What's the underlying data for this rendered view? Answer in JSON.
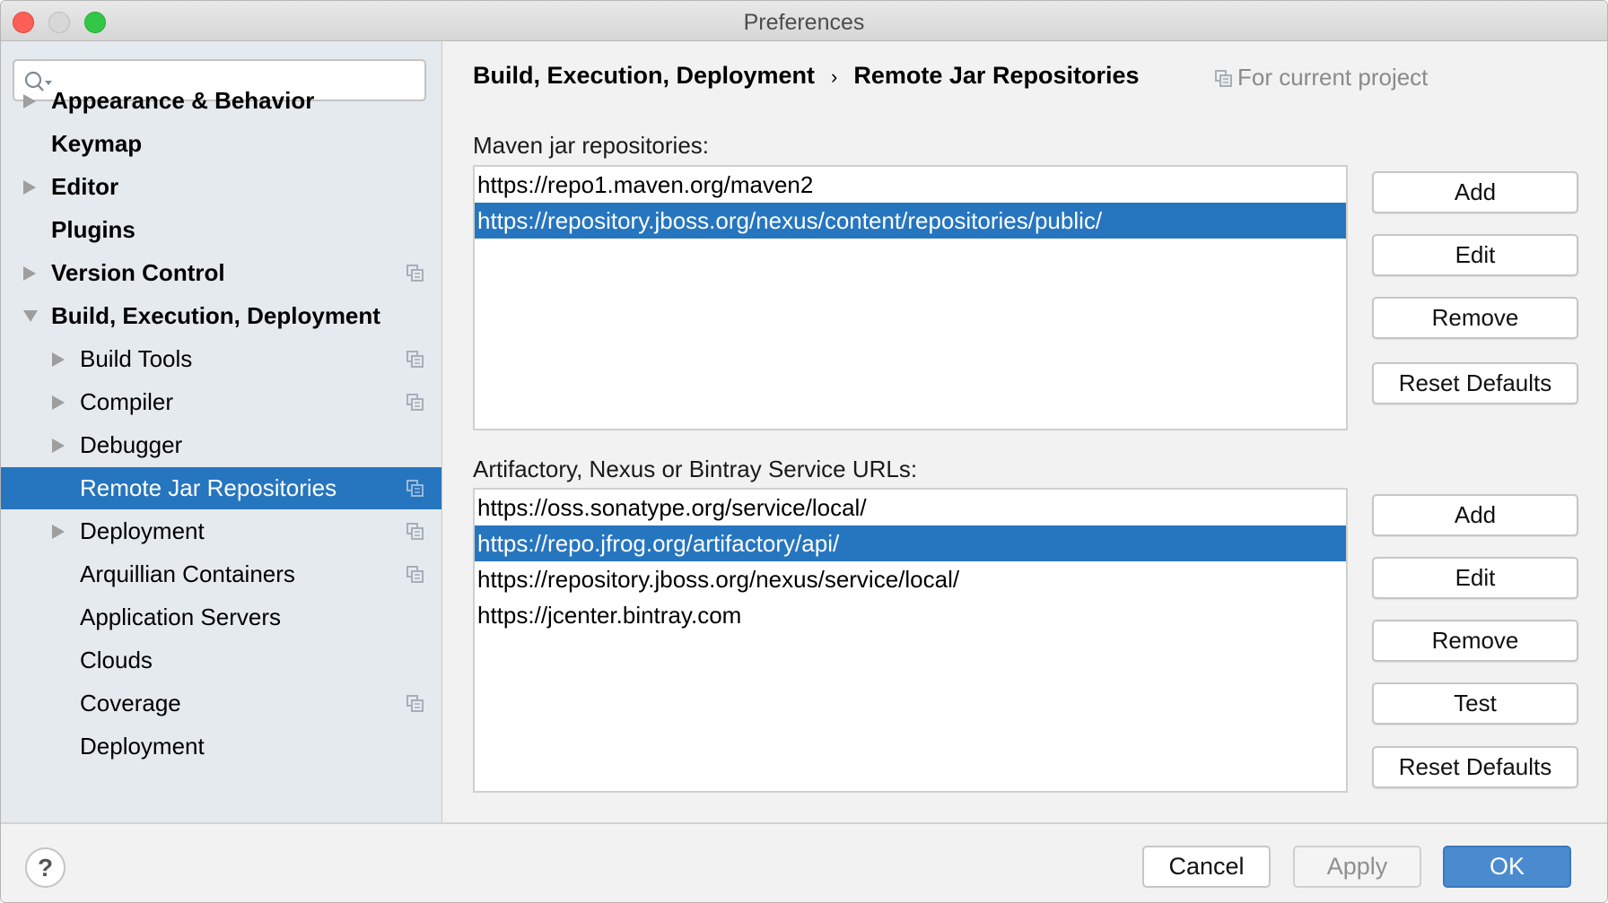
{
  "window": {
    "title": "Preferences"
  },
  "sidebar": {
    "search": {
      "value": "",
      "placeholder": ""
    },
    "items": [
      {
        "label": "Appearance & Behavior",
        "level": 0,
        "expandable": true,
        "expanded": false,
        "project_scoped": false,
        "selected": false
      },
      {
        "label": "Keymap",
        "level": 0,
        "expandable": false,
        "expanded": false,
        "project_scoped": false,
        "selected": false
      },
      {
        "label": "Editor",
        "level": 0,
        "expandable": true,
        "expanded": false,
        "project_scoped": false,
        "selected": false
      },
      {
        "label": "Plugins",
        "level": 0,
        "expandable": false,
        "expanded": false,
        "project_scoped": false,
        "selected": false
      },
      {
        "label": "Version Control",
        "level": 0,
        "expandable": true,
        "expanded": false,
        "project_scoped": true,
        "selected": false
      },
      {
        "label": "Build, Execution, Deployment",
        "level": 0,
        "expandable": true,
        "expanded": true,
        "project_scoped": false,
        "selected": false
      },
      {
        "label": "Build Tools",
        "level": 1,
        "expandable": true,
        "expanded": false,
        "project_scoped": true,
        "selected": false
      },
      {
        "label": "Compiler",
        "level": 1,
        "expandable": true,
        "expanded": false,
        "project_scoped": true,
        "selected": false
      },
      {
        "label": "Debugger",
        "level": 1,
        "expandable": true,
        "expanded": false,
        "project_scoped": false,
        "selected": false
      },
      {
        "label": "Remote Jar Repositories",
        "level": 1,
        "expandable": false,
        "expanded": false,
        "project_scoped": true,
        "selected": true
      },
      {
        "label": "Deployment",
        "level": 1,
        "expandable": true,
        "expanded": false,
        "project_scoped": true,
        "selected": false
      },
      {
        "label": "Arquillian Containers",
        "level": 1,
        "expandable": false,
        "expanded": false,
        "project_scoped": true,
        "selected": false
      },
      {
        "label": "Application Servers",
        "level": 1,
        "expandable": false,
        "expanded": false,
        "project_scoped": false,
        "selected": false
      },
      {
        "label": "Clouds",
        "level": 1,
        "expandable": false,
        "expanded": false,
        "project_scoped": false,
        "selected": false
      },
      {
        "label": "Coverage",
        "level": 1,
        "expandable": false,
        "expanded": false,
        "project_scoped": true,
        "selected": false
      },
      {
        "label": "Deployment",
        "level": 1,
        "expandable": false,
        "expanded": false,
        "project_scoped": false,
        "selected": false
      }
    ]
  },
  "header": {
    "breadcrumb": [
      "Build, Execution, Deployment",
      "Remote Jar Repositories"
    ],
    "breadcrumb_separator": "›",
    "scope_label": "For current project"
  },
  "maven": {
    "label": "Maven jar repositories:",
    "urls": [
      {
        "url": "https://repo1.maven.org/maven2",
        "selected": false
      },
      {
        "url": "https://repository.jboss.org/nexus/content/repositories/public/",
        "selected": true
      }
    ],
    "buttons": [
      "Add",
      "Edit",
      "Remove",
      "Reset Defaults"
    ]
  },
  "services": {
    "label": "Artifactory, Nexus or Bintray Service URLs:",
    "urls": [
      {
        "url": "https://oss.sonatype.org/service/local/",
        "selected": false
      },
      {
        "url": "https://repo.jfrog.org/artifactory/api/",
        "selected": true
      },
      {
        "url": "https://repository.jboss.org/nexus/service/local/",
        "selected": false
      },
      {
        "url": "https://jcenter.bintray.com",
        "selected": false
      }
    ],
    "buttons": [
      "Add",
      "Edit",
      "Remove",
      "Test",
      "Reset Defaults"
    ]
  },
  "footer": {
    "help": "?",
    "cancel": "Cancel",
    "apply": "Apply",
    "ok": "OK"
  },
  "colors": {
    "selection": "#2675bf",
    "primary_button": "#4a8bd0",
    "sidebar_bg": "#e5eaef",
    "close": "#fc5f57",
    "maximize": "#33c748"
  }
}
